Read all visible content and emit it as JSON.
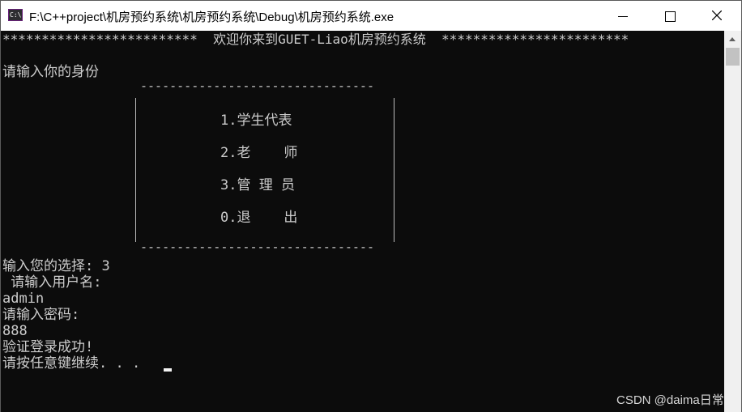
{
  "window": {
    "title": "F:\\C++project\\机房预约系统\\机房预约系统\\Debug\\机房预约系统.exe",
    "app_icon_text": "C:\\"
  },
  "console": {
    "banner": "*************************  欢迎你来到GUET-Liao机房预约系统  ************************",
    "prompt_identity": "请输入你的身份",
    "frame_rule": "--------------------------------",
    "menu": [
      "1.学生代表",
      "2.老    师",
      "3.管 理 员",
      "0.退    出"
    ],
    "choice_line": "输入您的选择: 3",
    "prompt_username": " 请输入用户名:",
    "username_value": "admin",
    "prompt_password": "请输入密码:",
    "password_value": "888",
    "result_message": "验证登录成功!",
    "press_any_key": "请按任意键继续. . ."
  },
  "watermark": "CSDN @daima日常",
  "colors": {
    "console_bg": "#0c0c0c",
    "console_fg": "#cccccc",
    "titlebar_bg": "#ffffff"
  }
}
